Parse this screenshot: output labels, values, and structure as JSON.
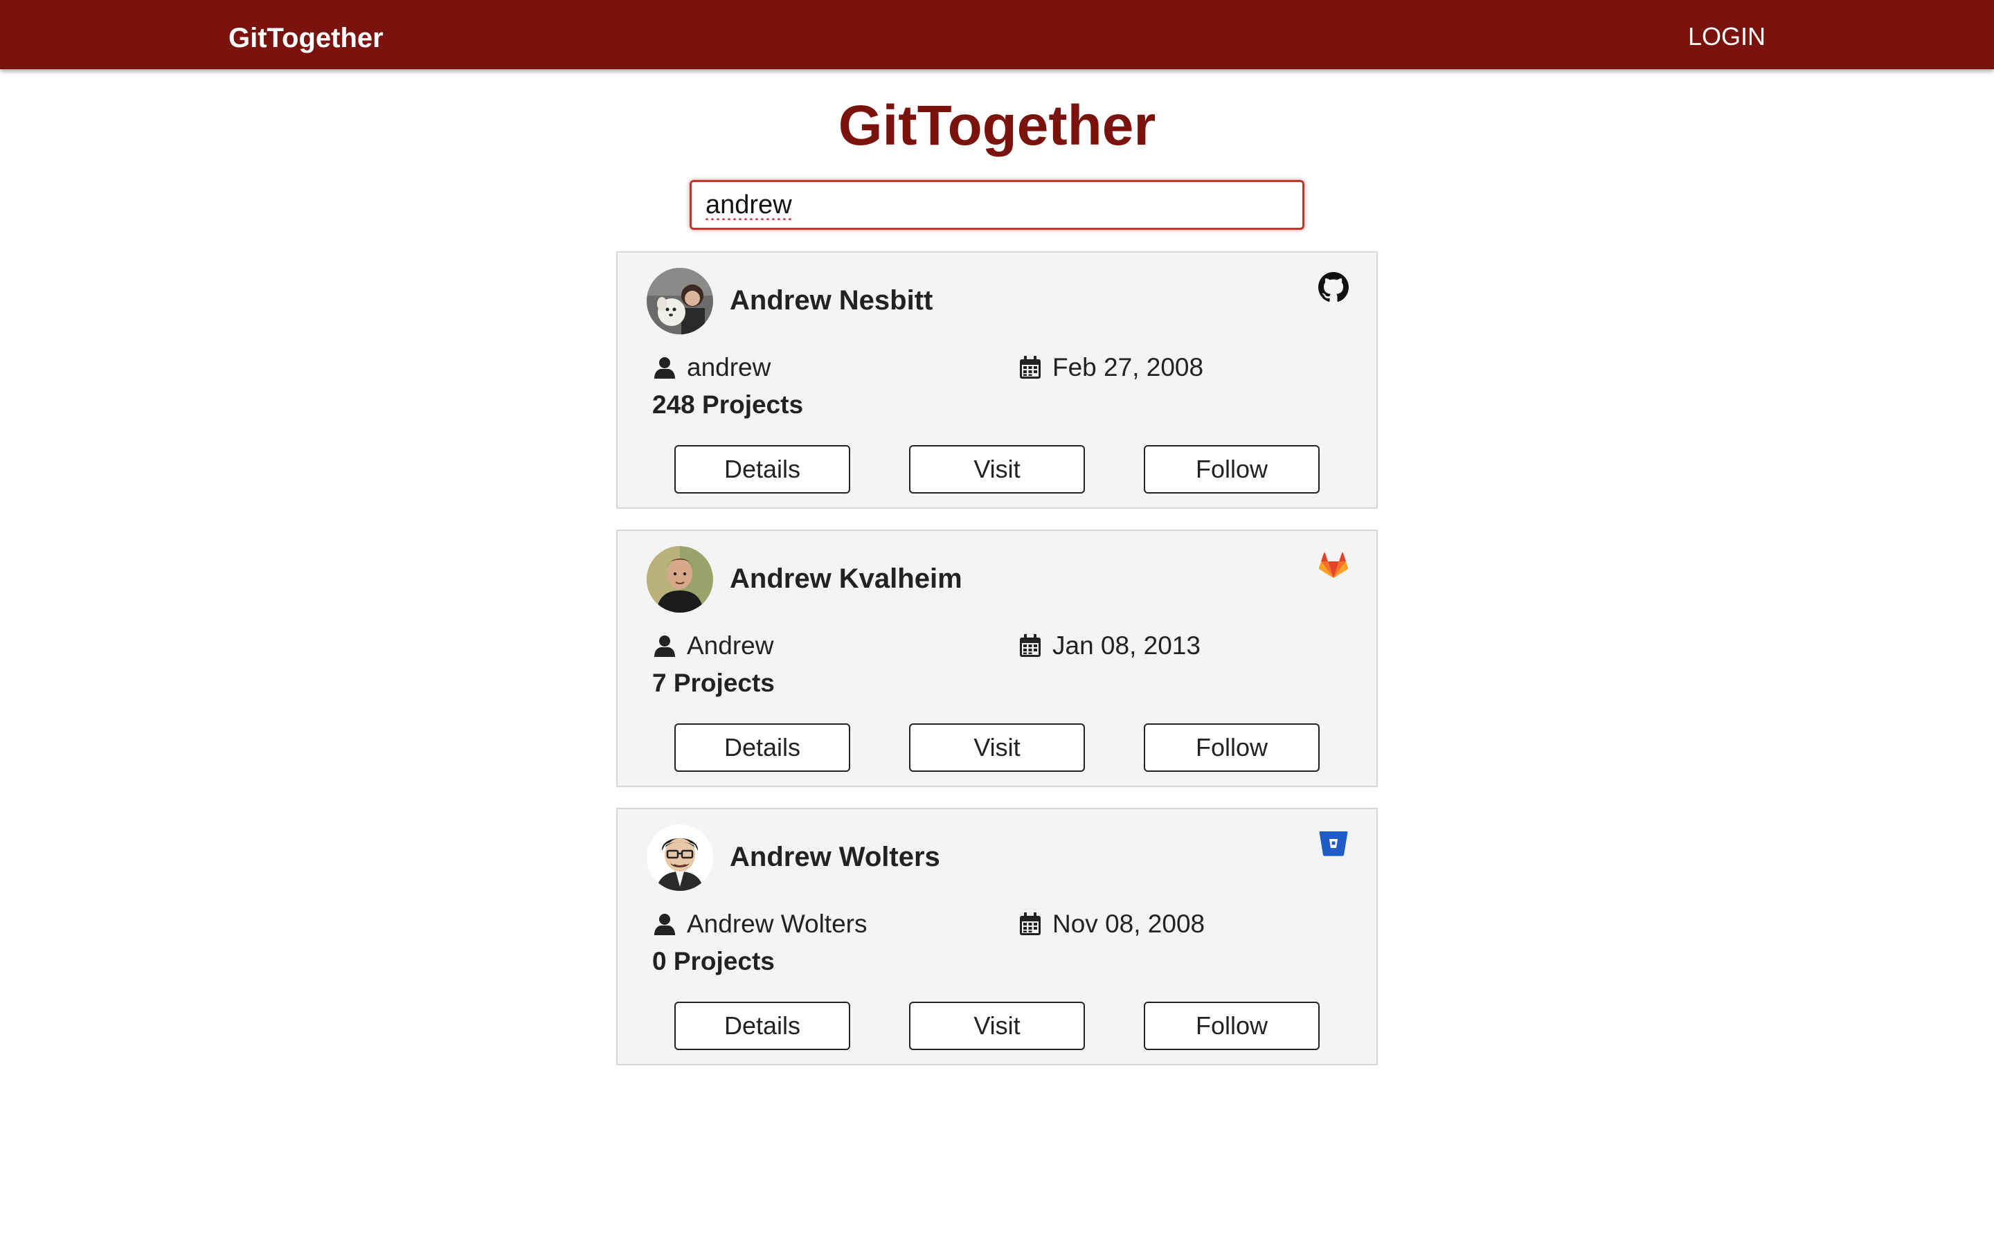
{
  "navbar": {
    "brand": "GitTogether",
    "login_label": "LOGIN"
  },
  "main": {
    "title": "GitTogether",
    "search": {
      "value": "andrew",
      "placeholder": ""
    }
  },
  "colors": {
    "brand": "#7a130d",
    "card_background": "#f4f4f4",
    "github": "#111111",
    "gitlab": "#e24329",
    "bitbucket": "#1f5cc8"
  },
  "results": [
    {
      "name": "Andrew Nesbitt",
      "username": "andrew",
      "joined": "Feb 27, 2008",
      "projects": "248 Projects",
      "provider_icon": "github-icon",
      "buttons": {
        "details": "Details",
        "visit": "Visit",
        "follow": "Follow"
      }
    },
    {
      "name": "Andrew Kvalheim",
      "username": "Andrew",
      "joined": "Jan 08, 2013",
      "projects": "7 Projects",
      "provider_icon": "gitlab-icon",
      "buttons": {
        "details": "Details",
        "visit": "Visit",
        "follow": "Follow"
      }
    },
    {
      "name": "Andrew Wolters",
      "username": "Andrew Wolters",
      "joined": "Nov 08, 2008",
      "projects": "0 Projects",
      "provider_icon": "bitbucket-icon",
      "buttons": {
        "details": "Details",
        "visit": "Visit",
        "follow": "Follow"
      }
    }
  ]
}
